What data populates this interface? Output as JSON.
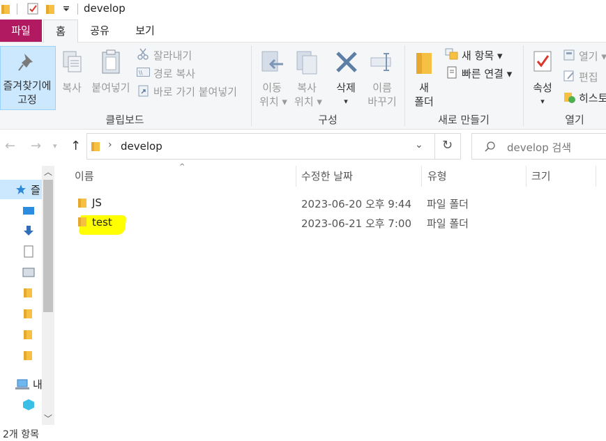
{
  "window": {
    "title": "develop"
  },
  "ribbon_tabs": [
    {
      "label": "파일"
    },
    {
      "label": "홈"
    },
    {
      "label": "공유"
    },
    {
      "label": "보기"
    }
  ],
  "ribbon": {
    "clipboard": {
      "pin_line1": "즐겨찾기에",
      "pin_line2": "고정",
      "copy": "복사",
      "paste": "붙여넣기",
      "cut": "잘라내기",
      "copy_path": "경로 복사",
      "paste_shortcut": "바로 가기 붙여넣기",
      "label": "클립보드"
    },
    "organize": {
      "move_line1": "이동",
      "move_line2": "위치",
      "copyto_line1": "복사",
      "copyto_line2": "위치",
      "delete": "삭제",
      "rename_line1": "이름",
      "rename_line2": "바꾸기",
      "label": "구성"
    },
    "new": {
      "new_item": "새 항목",
      "easy_access": "빠른 연결",
      "new_folder_line1": "새",
      "new_folder_line2": "폴더",
      "label": "새로 만들기"
    },
    "open": {
      "properties": "속성",
      "open": "열기",
      "edit": "편집",
      "history": "히스토",
      "label": "열기"
    }
  },
  "address": {
    "path": "develop",
    "search_placeholder": "develop 검색"
  },
  "columns": [
    {
      "label": "이름"
    },
    {
      "label": "수정한 날짜"
    },
    {
      "label": "유형"
    },
    {
      "label": "크기"
    }
  ],
  "files": [
    {
      "name": "JS",
      "modified": "2023-06-20 오후 9:44",
      "type": "파일 폴더"
    },
    {
      "name": "test",
      "modified": "2023-06-21 오후 7:00",
      "type": "파일 폴더"
    }
  ],
  "nav": {
    "quick_access": "즐",
    "this_pc": "내"
  },
  "status": {
    "count": "2개 항목"
  },
  "colors": {
    "file_tab": "#b11960",
    "highlight": "#ffff00",
    "folder": "#f6c143"
  }
}
